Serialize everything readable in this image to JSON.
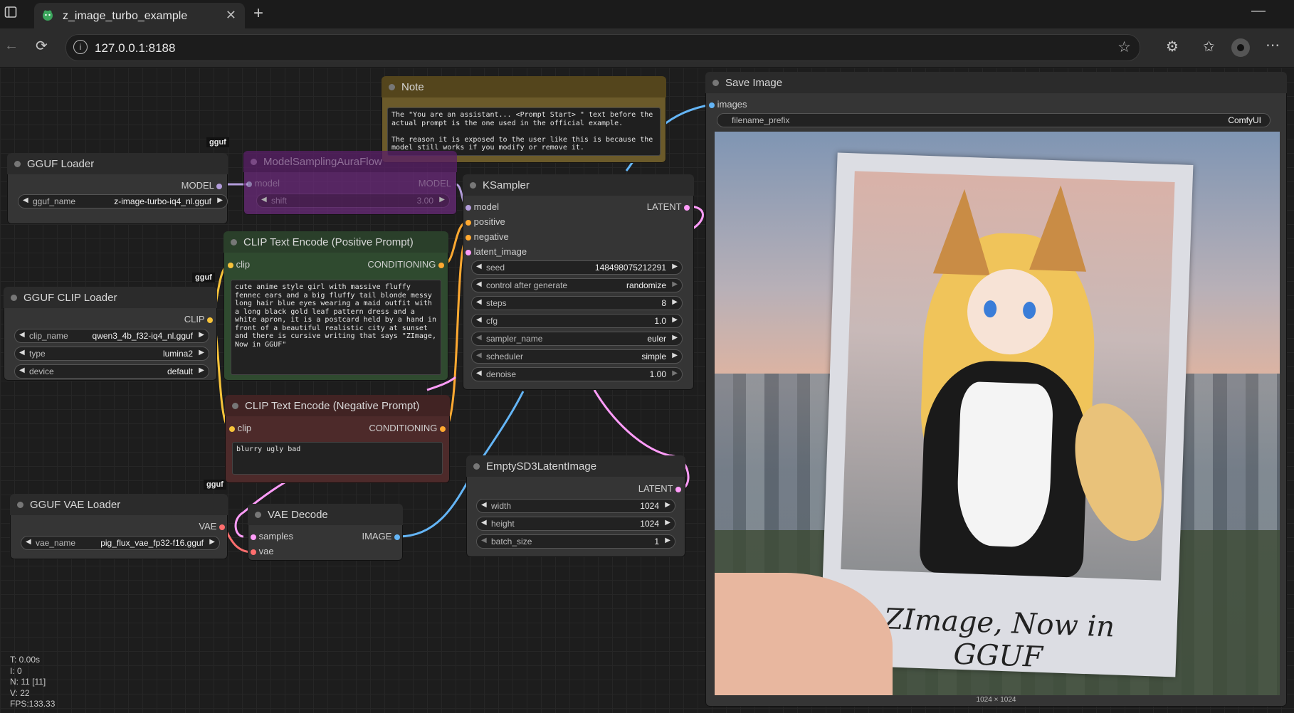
{
  "browser": {
    "tab_title": "z_image_turbo_example",
    "url": "127.0.0.1:8188"
  },
  "badges": {
    "gguf1": "gguf",
    "gguf2": "gguf",
    "gguf3": "gguf"
  },
  "nodes": {
    "note": {
      "title": "Note",
      "text": "The \"You are an assistant... <Prompt Start> \" text before the actual prompt is the one used in the official example.\n\nThe reason it is exposed to the user like this is because the model still works if you modify or remove it."
    },
    "gguf_loader": {
      "title": "GGUF Loader",
      "out_model": "MODEL",
      "w_label": "gguf_name",
      "w_value": "z-image-turbo-iq4_nl.gguf"
    },
    "model_sampling": {
      "title": "ModelSamplingAuraFlow",
      "in_model": "model",
      "out_model": "MODEL",
      "w_label": "shift",
      "w_value": "3.00"
    },
    "clip_positive": {
      "title": "CLIP Text Encode (Positive Prompt)",
      "in_clip": "clip",
      "out": "CONDITIONING",
      "text": "cute anime style girl with massive fluffy fennec ears and a big fluffy tail blonde messy long hair blue eyes wearing a maid outfit with a long black gold leaf pattern dress and a white apron, it is a postcard held by a hand in front of a beautiful realistic city at sunset and there is cursive writing that says \"ZImage, Now in GGUF\""
    },
    "clip_negative": {
      "title": "CLIP Text Encode (Negative Prompt)",
      "in_clip": "clip",
      "out": "CONDITIONING",
      "text": "blurry ugly bad"
    },
    "clip_loader": {
      "title": "GGUF CLIP Loader",
      "out_clip": "CLIP",
      "w1_label": "clip_name",
      "w1_value": "qwen3_4b_f32-iq4_nl.gguf",
      "w2_label": "type",
      "w2_value": "lumina2",
      "w3_label": "device",
      "w3_value": "default"
    },
    "ksampler": {
      "title": "KSampler",
      "in_model": "model",
      "in_positive": "positive",
      "in_negative": "negative",
      "in_latent": "latent_image",
      "out_latent": "LATENT",
      "seed_label": "seed",
      "seed_value": "148498075212291",
      "control_label": "control after generate",
      "control_value": "randomize",
      "steps_label": "steps",
      "steps_value": "8",
      "cfg_label": "cfg",
      "cfg_value": "1.0",
      "sampler_label": "sampler_name",
      "sampler_value": "euler",
      "scheduler_label": "scheduler",
      "scheduler_value": "simple",
      "denoise_label": "denoise",
      "denoise_value": "1.00"
    },
    "vae_loader": {
      "title": "GGUF VAE Loader",
      "out_vae": "VAE",
      "w_label": "vae_name",
      "w_value": "pig_flux_vae_fp32-f16.gguf"
    },
    "vae_decode": {
      "title": "VAE Decode",
      "in_samples": "samples",
      "in_vae": "vae",
      "out_image": "IMAGE"
    },
    "empty_latent": {
      "title": "EmptySD3LatentImage",
      "out_latent": "LATENT",
      "width_label": "width",
      "width_value": "1024",
      "height_label": "height",
      "height_value": "1024",
      "batch_label": "batch_size",
      "batch_value": "1"
    },
    "save_image": {
      "title": "Save Image",
      "in_images": "images",
      "w_label": "filename_prefix",
      "w_value": "ComfyUI",
      "image_caption": "ZImage, Now in GGUF",
      "image_size": "1024 × 1024"
    }
  },
  "stats": {
    "t": "T: 0.00s",
    "i": "I: 0",
    "n": "N: 11 [11]",
    "v": "V: 22",
    "fps": "FPS:133.33"
  },
  "colors": {
    "clip": "#f7c33a",
    "model": "#b39ddb",
    "latent": "#ff9cf9",
    "image": "#64b5f6",
    "vae": "#ff6e6e",
    "conditioning": "#ffa931"
  }
}
